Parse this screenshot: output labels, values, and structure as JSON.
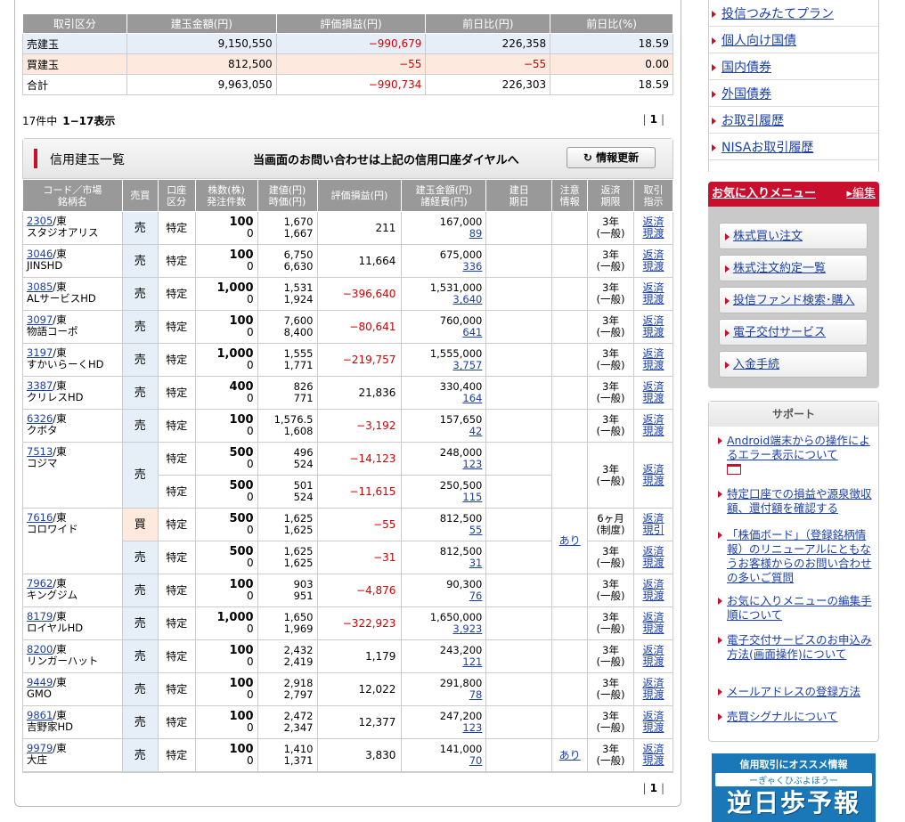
{
  "summary": {
    "headers": [
      "取引区分",
      "建玉金額(円)",
      "評価損益(円)",
      "前日比(円)",
      "前日比(%)"
    ],
    "rows": [
      [
        "売建玉",
        "9,150,550",
        "−990,679",
        "226,358",
        "18.59"
      ],
      [
        "買建玉",
        "812,500",
        "−55",
        "−55",
        "0.00"
      ],
      [
        "合計",
        "9,963,050",
        "−990,734",
        "226,303",
        "18.59"
      ]
    ]
  },
  "count": {
    "total": "17件中",
    "range": "1−17表示"
  },
  "pager": {
    "prefix": "|",
    "current": "1",
    "suffix": "|"
  },
  "panel": {
    "title": "信用建玉一覧",
    "message": "当画面のお問い合わせは上記の信用口座ダイヤルへ",
    "refresh": "情報更新",
    "refresh_icon": "refresh-icon"
  },
  "columns": [
    "コード／市場\n銘柄名",
    "売買",
    "口座\n区分",
    "株数(株)\n発注件数",
    "建値(円)\n時価(円)",
    "評価損益(円)",
    "建玉金額(円)\n諸経費(円)",
    "建日\n期日",
    "注意\n情報",
    "返済\n期限",
    "取引\n指示"
  ],
  "positions": [
    {
      "code": "2305",
      "market": "/東",
      "name": "スタジオアリス",
      "lots": [
        {
          "side": "売",
          "acct": "特定",
          "qty": "100",
          "orders": "0",
          "price": "1,670",
          "now": "1,667",
          "pnl": "211",
          "amount": "167,000",
          "cost": "89",
          "term": "3年\n(一般)",
          "act": "返済\n現渡"
        }
      ]
    },
    {
      "code": "3046",
      "market": "/東",
      "name": "JINSHD",
      "lots": [
        {
          "side": "売",
          "acct": "特定",
          "qty": "100",
          "orders": "0",
          "price": "6,750",
          "now": "6,630",
          "pnl": "11,664",
          "amount": "675,000",
          "cost": "336",
          "term": "3年\n(一般)",
          "act": "返済\n現渡"
        }
      ]
    },
    {
      "code": "3085",
      "market": "/東",
      "name": "ALサービスHD",
      "lots": [
        {
          "side": "売",
          "acct": "特定",
          "qty": "1,000",
          "orders": "0",
          "price": "1,531",
          "now": "1,924",
          "pnl": "−396,640",
          "neg": true,
          "amount": "1,531,000",
          "cost": "3,640",
          "term": "3年\n(一般)",
          "act": "返済\n現渡"
        }
      ]
    },
    {
      "code": "3097",
      "market": "/東",
      "name": "物語コーポ",
      "lots": [
        {
          "side": "売",
          "acct": "特定",
          "qty": "100",
          "orders": "0",
          "price": "7,600",
          "now": "8,400",
          "pnl": "−80,641",
          "neg": true,
          "amount": "760,000",
          "cost": "641",
          "term": "3年\n(一般)",
          "act": "返済\n現渡"
        }
      ]
    },
    {
      "code": "3197",
      "market": "/東",
      "name": "すかいらーくHD",
      "lots": [
        {
          "side": "売",
          "acct": "特定",
          "qty": "1,000",
          "orders": "0",
          "price": "1,555",
          "now": "1,771",
          "pnl": "−219,757",
          "neg": true,
          "amount": "1,555,000",
          "cost": "3,757",
          "term": "3年\n(一般)",
          "act": "返済\n現渡"
        }
      ]
    },
    {
      "code": "3387",
      "market": "/東",
      "name": "クリレスHD",
      "lots": [
        {
          "side": "売",
          "acct": "特定",
          "qty": "400",
          "orders": "0",
          "price": "826",
          "now": "771",
          "pnl": "21,836",
          "amount": "330,400",
          "cost": "164",
          "term": "3年\n(一般)",
          "act": "返済\n現渡"
        }
      ]
    },
    {
      "code": "6326",
      "market": "/東",
      "name": "クボタ",
      "lots": [
        {
          "side": "売",
          "acct": "特定",
          "qty": "100",
          "orders": "0",
          "price": "1,576.5",
          "now": "1,608",
          "pnl": "−3,192",
          "neg": true,
          "amount": "157,650",
          "cost": "42",
          "term": "3年\n(一般)",
          "act": "返済\n現渡"
        }
      ]
    },
    {
      "code": "7513",
      "market": "/東",
      "name": "コジマ",
      "lots": [
        {
          "side": "売",
          "acct": "特定",
          "qty": "500",
          "orders": "0",
          "price": "496",
          "now": "524",
          "pnl": "−14,123",
          "neg": true,
          "amount": "248,000",
          "cost": "123",
          "term": "3年\n(一般)",
          "act": "返済\n現渡"
        },
        {
          "side": "",
          "acct": "特定",
          "qty": "500",
          "orders": "0",
          "price": "501",
          "now": "524",
          "pnl": "−11,615",
          "neg": true,
          "amount": "250,500",
          "cost": "115",
          "term": "",
          "act": ""
        }
      ]
    },
    {
      "code": "7616",
      "market": "/東",
      "name": "コロワイド",
      "note": "あり",
      "lots": [
        {
          "side": "買",
          "acct": "特定",
          "qty": "500",
          "orders": "0",
          "price": "1,625",
          "now": "1,625",
          "pnl": "−55",
          "neg": true,
          "amount": "812,500",
          "cost": "55",
          "term": "6ヶ月\n(制度)",
          "act": "返済\n現引"
        },
        {
          "side": "売",
          "acct": "特定",
          "qty": "500",
          "orders": "0",
          "price": "1,625",
          "now": "1,625",
          "pnl": "−31",
          "neg": true,
          "amount": "812,500",
          "cost": "31",
          "term": "3年\n(一般)",
          "act": "返済\n現渡"
        }
      ]
    },
    {
      "code": "7962",
      "market": "/東",
      "name": "キングジム",
      "lots": [
        {
          "side": "売",
          "acct": "特定",
          "qty": "100",
          "orders": "0",
          "price": "903",
          "now": "951",
          "pnl": "−4,876",
          "neg": true,
          "amount": "90,300",
          "cost": "76",
          "term": "3年\n(一般)",
          "act": "返済\n現渡"
        }
      ]
    },
    {
      "code": "8179",
      "market": "/東",
      "name": "ロイヤルHD",
      "lots": [
        {
          "side": "売",
          "acct": "特定",
          "qty": "1,000",
          "orders": "0",
          "price": "1,650",
          "now": "1,969",
          "pnl": "−322,923",
          "neg": true,
          "amount": "1,650,000",
          "cost": "3,923",
          "term": "3年\n(一般)",
          "act": "返済\n現渡"
        }
      ]
    },
    {
      "code": "8200",
      "market": "/東",
      "name": "リンガーハット",
      "lots": [
        {
          "side": "売",
          "acct": "特定",
          "qty": "100",
          "orders": "0",
          "price": "2,432",
          "now": "2,419",
          "pnl": "1,179",
          "amount": "243,200",
          "cost": "121",
          "term": "3年\n(一般)",
          "act": "返済\n現渡"
        }
      ]
    },
    {
      "code": "9449",
      "market": "/東",
      "name": "GMO",
      "lots": [
        {
          "side": "売",
          "acct": "特定",
          "qty": "100",
          "orders": "0",
          "price": "2,918",
          "now": "2,797",
          "pnl": "12,022",
          "amount": "291,800",
          "cost": "78",
          "term": "3年\n(一般)",
          "act": "返済\n現渡"
        }
      ]
    },
    {
      "code": "9861",
      "market": "/東",
      "name": "吉野家HD",
      "lots": [
        {
          "side": "売",
          "acct": "特定",
          "qty": "100",
          "orders": "0",
          "price": "2,472",
          "now": "2,347",
          "pnl": "12,377",
          "amount": "247,200",
          "cost": "123",
          "term": "3年\n(一般)",
          "act": "返済\n現渡"
        }
      ]
    },
    {
      "code": "9979",
      "market": "/東",
      "name": "大庄",
      "note": "あり",
      "lots": [
        {
          "side": "売",
          "acct": "特定",
          "qty": "100",
          "orders": "0",
          "price": "1,410",
          "now": "1,371",
          "pnl": "3,830",
          "amount": "141,000",
          "cost": "70",
          "term": "3年\n(一般)",
          "act": "返済\n現渡"
        }
      ]
    }
  ],
  "sidebar": {
    "nav": [
      "投信つみたてプラン",
      "個人向け国債",
      "国内債券",
      "外国債券",
      "お取引履歴",
      "NISAお取引履歴"
    ],
    "favorites": {
      "title": "お気に入りメニュー",
      "edit": "編集",
      "items": [
        "株式買い注文",
        "株式注文約定一覧",
        "投信ファンド検索･購入",
        "電子交付サービス",
        "入金手続"
      ]
    },
    "support": {
      "title": "サポート",
      "items": [
        "Android端末からの操作によるエラー表示について",
        "特定口座での損益や源泉徴収額、還付額を確認する",
        "「株価ボード」（登録銘柄情報）のリニューアルにともなうお客様からのお問い合わせの多いご質問",
        "お気に入りメニューの編集手順について",
        "電子交付サービスのお申込み方法(画面操作)について",
        "メールアドレスの登録方法",
        "売買シグナルについて"
      ]
    },
    "banner": {
      "line1": "信用取引にオススメ情報",
      "line2": "ーぎゃくひぶよほうー",
      "line3": "逆日歩予報"
    }
  },
  "colors": {
    "accent": "#c8102e",
    "negative": "#d40000",
    "header": "#999999",
    "sell_bg": "#e6eef7",
    "buy_bg": "#fde9dd"
  }
}
